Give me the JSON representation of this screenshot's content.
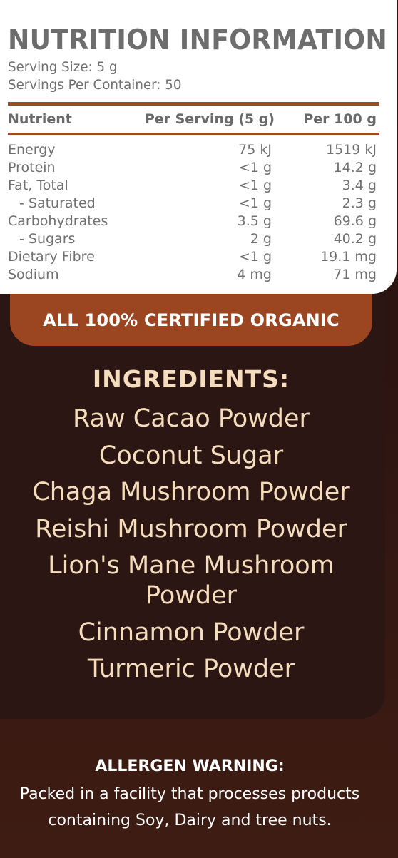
{
  "nutrition": {
    "title": "NUTRITION INFORMATION",
    "serving_size": "Serving Size: 5 g",
    "servings_per_container": "Servings Per Container: 50",
    "headers": {
      "nutrient": "Nutrient",
      "per_serving": "Per Serving (5 g)",
      "per_100g": "Per 100 g"
    },
    "rows": [
      {
        "nutrient": "Energy",
        "per_serving": "75 kJ",
        "per_100g": "1519 kJ"
      },
      {
        "nutrient": "Protein",
        "per_serving": "<1 g",
        "per_100g": "14.2 g"
      },
      {
        "nutrient": "Fat, Total",
        "per_serving": "<1 g",
        "per_100g": "3.4 g"
      },
      {
        "nutrient": "- Saturated",
        "per_serving": "<1 g",
        "per_100g": "2.3 g"
      },
      {
        "nutrient": "Carbohydrates",
        "per_serving": "3.5 g",
        "per_100g": "69.6 g"
      },
      {
        "nutrient": "- Sugars",
        "per_serving": "2 g",
        "per_100g": "40.2 g"
      },
      {
        "nutrient": "Dietary Fibre",
        "per_serving": "<1 g",
        "per_100g": "19.1 mg"
      },
      {
        "nutrient": "Sodium",
        "per_serving": "4 mg",
        "per_100g": "71 mg"
      }
    ]
  },
  "organic_banner": "ALL 100% CERTIFIED ORGANIC",
  "ingredients": {
    "title": "INGREDIENTS:",
    "items": [
      "Raw Cacao Powder",
      "Coconut Sugar",
      "Chaga Mushroom Powder",
      "Reishi Mushroom Powder",
      "Lion's Mane Mushroom Powder",
      "Cinnamon Powder",
      "Turmeric Powder"
    ]
  },
  "allergen": {
    "title": "ALLERGEN WARNING:",
    "text": "Packed in a facility that processes products containing Soy, Dairy and tree nuts."
  },
  "colors": {
    "accent": "#9c4521",
    "background": "#2b1613",
    "ingredient_text": "#f4dcbc",
    "label_text": "#6f6f6f"
  }
}
